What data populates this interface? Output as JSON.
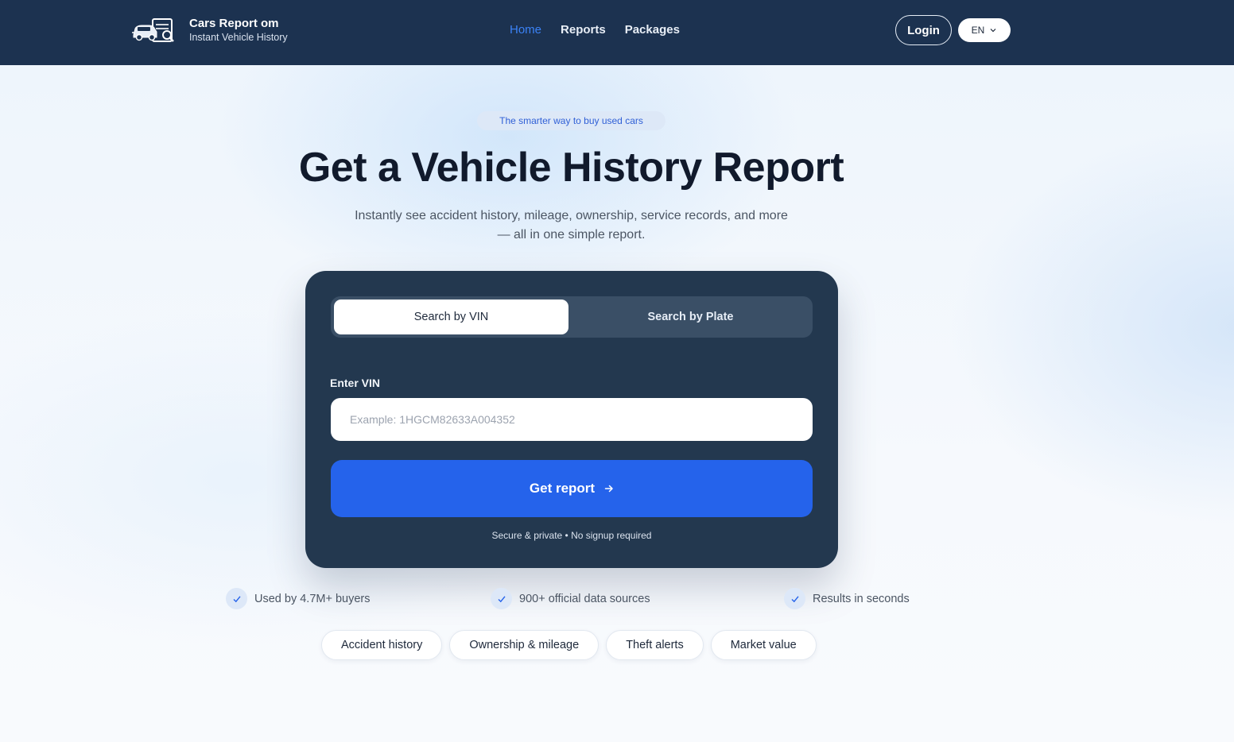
{
  "header": {
    "brand_name": "Cars Report om",
    "brand_tagline": "Instant Vehicle History",
    "logo_icon": "car-report-logo-icon",
    "nav": [
      {
        "label": "Home",
        "active": true
      },
      {
        "label": "Reports",
        "active": false
      },
      {
        "label": "Packages",
        "active": false
      }
    ],
    "login_label": "Login",
    "language": "EN"
  },
  "hero": {
    "badge": "The smarter way to buy used cars",
    "title": "Get a Vehicle History Report",
    "subtitle_line1": "Instantly see accident history, mileage, ownership, service records, and more",
    "subtitle_line2": "— all in one simple report."
  },
  "search": {
    "tabs": [
      {
        "label": "Search by VIN",
        "selected": true
      },
      {
        "label": "Search by Plate",
        "selected": false
      }
    ],
    "field_label": "Enter VIN",
    "input_value": "",
    "input_placeholder": "Example: 1HGCM82633A004352",
    "button_label": "Get report",
    "button_icon": "arrow-right-icon",
    "note": "Secure & private • No signup required"
  },
  "trust": [
    {
      "icon": "check-icon",
      "label": "Used by 4.7M+ buyers"
    },
    {
      "icon": "check-icon",
      "label": "900+ official data sources"
    },
    {
      "icon": "check-icon",
      "label": "Results in seconds"
    }
  ],
  "features": [
    {
      "label": "Accident history"
    },
    {
      "label": "Ownership & mileage"
    },
    {
      "label": "Theft alerts"
    },
    {
      "label": "Market value"
    }
  ],
  "colors": {
    "header_bg": "#1c3250",
    "card_bg": "#23384f",
    "accent": "#2563eb",
    "nav_active": "#3b82f6"
  }
}
